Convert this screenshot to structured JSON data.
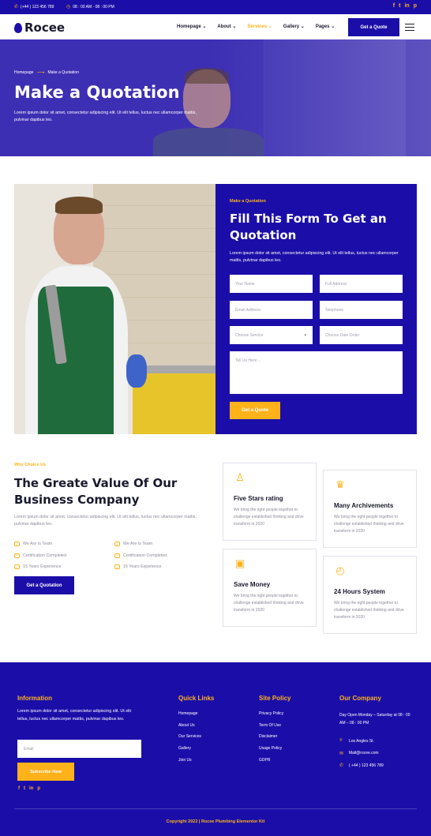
{
  "topbar": {
    "phone": "(+44 ) 123 456 789",
    "hours": "08 : 00 AM - 08 : 00 PM",
    "socials": [
      "f",
      "t",
      "in",
      "p"
    ]
  },
  "header": {
    "logo_text": "Rocee",
    "nav": [
      {
        "label": "Homepage ⌄"
      },
      {
        "label": "About ⌄"
      },
      {
        "label": "Services ⌄"
      },
      {
        "label": "Gallery ⌄"
      },
      {
        "label": "Pages ⌄"
      }
    ],
    "active_nav": "Services",
    "cta": "Get a Quote"
  },
  "hero": {
    "breadcrumb_home": "Homepage",
    "breadcrumb_current": "Make a Quotation",
    "title": "Make a Quotation",
    "description": "Lorem ipsum dolor sit amet, consectetur adipiscing elit. Ut elit tellus, luctus nec ullamcorper mattis, pulvinar dapibus leo."
  },
  "form": {
    "kicker": "Make a Quotation",
    "heading": "Fill This Form To Get an Quotation",
    "text": "Lorem ipsum dolor sit amet, consectetur adipiscing elit. Ut elit tellus, luctus nec ullamcorper mattis, pulvinar dapibus leo.",
    "your_name": "Your Name",
    "full_address": "Full Address",
    "email": "Email Address",
    "telephone": "Telephone",
    "choose_service": "Choose Service",
    "choose_date": "Choose Date Order",
    "message": "Tell Us Here ...",
    "submit": "Get a Quote"
  },
  "why": {
    "kicker": "Why Choice Us",
    "heading": "The Greate Value Of Our Business Company",
    "text": "Lorem ipsum dolor sit amet, consectetur adipiscing elit. Ut elit tellus, luctus nec ullamcorper mattis, pulvinar dapibus leo.",
    "features_left": [
      "We Are Is Team",
      "Certification Completed",
      "15 Years Experience"
    ],
    "features_right": [
      "We Are Is Team",
      "Certification Completed",
      "15 Years Experience"
    ],
    "cta": "Get a Quotation"
  },
  "cards": [
    {
      "title": "Five Stars rating",
      "text": "We bring the right people together to challenge established thinking and drive transform in 2020",
      "icon": "people-icon"
    },
    {
      "title": "Many Archivements",
      "text": "We bring the right people together to challenge established thinking and drive transform in 2020",
      "icon": "trophy-icon"
    },
    {
      "title": "Save Money",
      "text": "We bring the right people together to challenge established thinking and drive transform in 2020",
      "icon": "wallet-icon"
    },
    {
      "title": "24 Hours System",
      "text": "We bring the right people together to challenge established thinking and drive transform in 2020",
      "icon": "clock-icon"
    }
  ],
  "footer": {
    "info_title": "Information",
    "info_text": "Lorem ipsum dolor sit amet, consectetur adipiscing elit. Ut elit tellus, luctus nec ullamcorper mattis, pulvinar dapibus leo.",
    "email_placeholder": "Email",
    "subscribe": "Subscribe Now",
    "quick_title": "Quick Links",
    "quick_links": [
      "Homepage",
      "About Us",
      "Our Services",
      "Gallery",
      "Join Us"
    ],
    "policy_title": "Site Policy",
    "policy_links": [
      "Privacy Policy",
      "Term Of Use",
      "Disclaimer",
      "Usage Policy",
      "GDPR"
    ],
    "company_title": "Our Company",
    "company_hours": "Day Open Monday – Saturday at 08 : 00 AM – 08 : 00 PM",
    "address": "Los Angles St.",
    "mail": "Mail@rocee.com",
    "phone": "( +44 ) 123 456 789",
    "copyright": "Copyright 2022 | Rocee Plumbing Elementor Kit"
  },
  "colors": {
    "brand": "#1b0ea8",
    "accent": "#ffb21a"
  }
}
